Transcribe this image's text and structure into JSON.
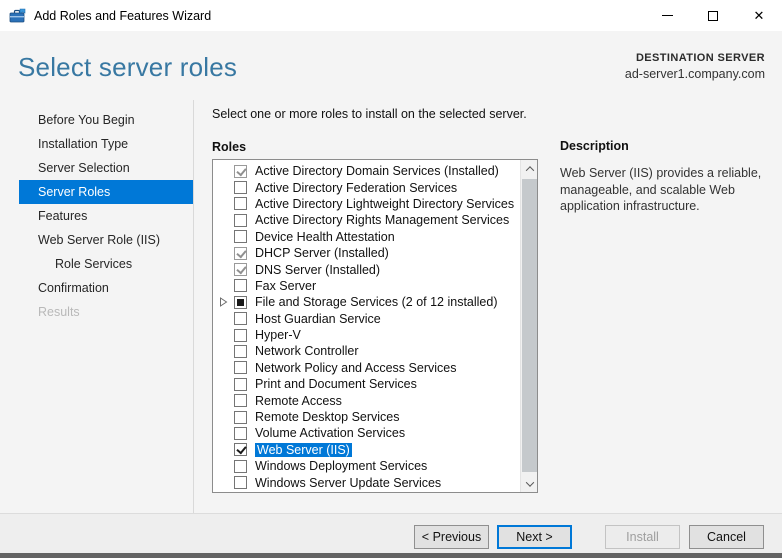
{
  "window": {
    "title": "Add Roles and Features Wizard",
    "close_icon_glyph": "✕"
  },
  "header": {
    "title": "Select server roles",
    "destination_label": "DESTINATION SERVER",
    "destination_server": "ad-server1.company.com"
  },
  "sidebar": {
    "items": [
      {
        "label": "Before You Begin",
        "state": "normal",
        "indent": false
      },
      {
        "label": "Installation Type",
        "state": "normal",
        "indent": false
      },
      {
        "label": "Server Selection",
        "state": "normal",
        "indent": false
      },
      {
        "label": "Server Roles",
        "state": "active",
        "indent": false
      },
      {
        "label": "Features",
        "state": "normal",
        "indent": false
      },
      {
        "label": "Web Server Role (IIS)",
        "state": "normal",
        "indent": false
      },
      {
        "label": "Role Services",
        "state": "normal",
        "indent": true
      },
      {
        "label": "Confirmation",
        "state": "normal",
        "indent": false
      },
      {
        "label": "Results",
        "state": "disabled",
        "indent": false
      }
    ]
  },
  "main": {
    "instruction": "Select one or more roles to install on the selected server.",
    "roles_label": "Roles",
    "roles": [
      {
        "label": "Active Directory Domain Services (Installed)",
        "checkbox": "checked-gray",
        "expander": false,
        "selected": false
      },
      {
        "label": "Active Directory Federation Services",
        "checkbox": "unchecked",
        "expander": false,
        "selected": false
      },
      {
        "label": "Active Directory Lightweight Directory Services",
        "checkbox": "unchecked",
        "expander": false,
        "selected": false
      },
      {
        "label": "Active Directory Rights Management Services",
        "checkbox": "unchecked",
        "expander": false,
        "selected": false
      },
      {
        "label": "Device Health Attestation",
        "checkbox": "unchecked",
        "expander": false,
        "selected": false
      },
      {
        "label": "DHCP Server (Installed)",
        "checkbox": "checked-gray",
        "expander": false,
        "selected": false
      },
      {
        "label": "DNS Server (Installed)",
        "checkbox": "checked-gray",
        "expander": false,
        "selected": false
      },
      {
        "label": "Fax Server",
        "checkbox": "unchecked",
        "expander": false,
        "selected": false
      },
      {
        "label": "File and Storage Services (2 of 12 installed)",
        "checkbox": "indeterminate",
        "expander": true,
        "selected": false
      },
      {
        "label": "Host Guardian Service",
        "checkbox": "unchecked",
        "expander": false,
        "selected": false
      },
      {
        "label": "Hyper-V",
        "checkbox": "unchecked",
        "expander": false,
        "selected": false
      },
      {
        "label": "Network Controller",
        "checkbox": "unchecked",
        "expander": false,
        "selected": false
      },
      {
        "label": "Network Policy and Access Services",
        "checkbox": "unchecked",
        "expander": false,
        "selected": false
      },
      {
        "label": "Print and Document Services",
        "checkbox": "unchecked",
        "expander": false,
        "selected": false
      },
      {
        "label": "Remote Access",
        "checkbox": "unchecked",
        "expander": false,
        "selected": false
      },
      {
        "label": "Remote Desktop Services",
        "checkbox": "unchecked",
        "expander": false,
        "selected": false
      },
      {
        "label": "Volume Activation Services",
        "checkbox": "unchecked",
        "expander": false,
        "selected": false
      },
      {
        "label": "Web Server (IIS)",
        "checkbox": "checked",
        "expander": false,
        "selected": true
      },
      {
        "label": "Windows Deployment Services",
        "checkbox": "unchecked",
        "expander": false,
        "selected": false
      },
      {
        "label": "Windows Server Update Services",
        "checkbox": "unchecked",
        "expander": false,
        "selected": false
      }
    ]
  },
  "description": {
    "heading": "Description",
    "text": "Web Server (IIS) provides a reliable, manageable, and scalable Web application infrastructure."
  },
  "footer": {
    "previous_label": "< Previous",
    "next_label": "Next >",
    "install_label": "Install",
    "cancel_label": "Cancel"
  },
  "colors": {
    "accent": "#0078d7",
    "heading": "#3878a2",
    "footer_bg": "#eeeeee"
  }
}
